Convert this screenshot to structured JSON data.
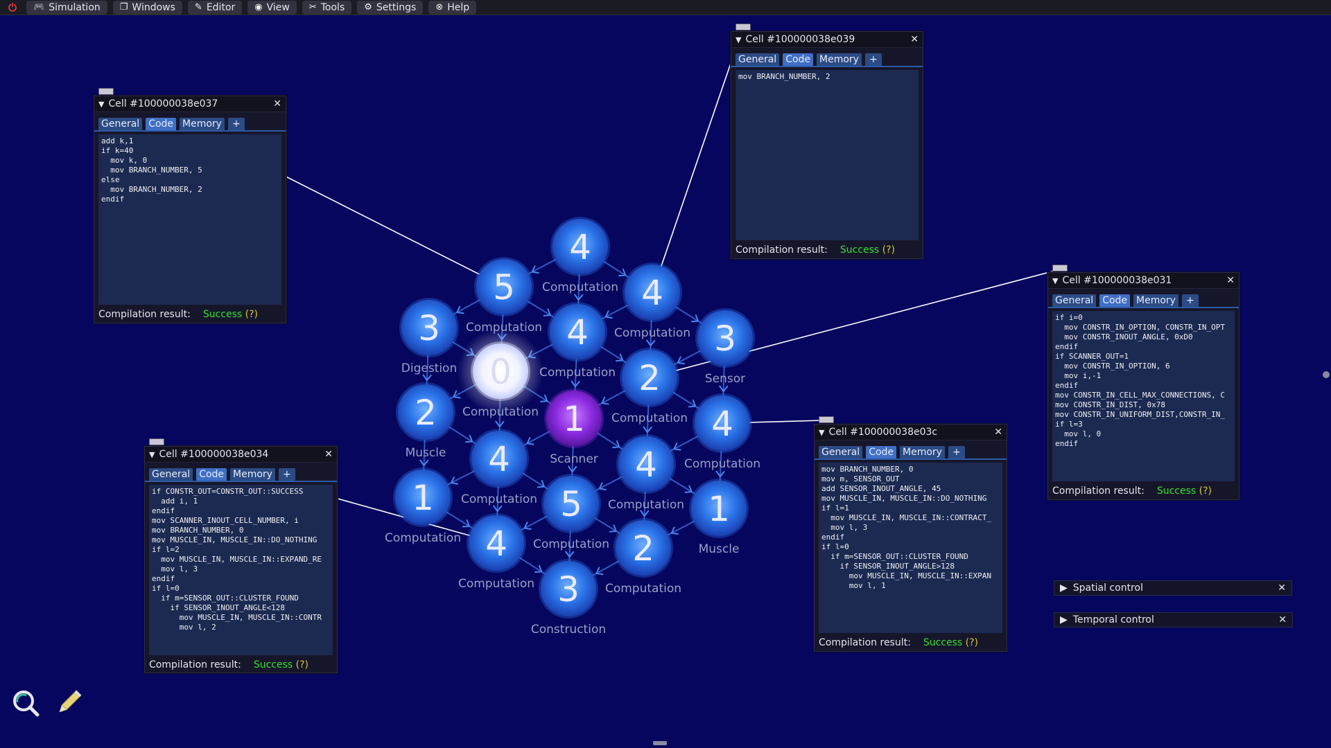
{
  "menubar": {
    "items": [
      {
        "label": "Simulation",
        "icon": "gamepad-icon"
      },
      {
        "label": "Windows",
        "icon": "windows-icon"
      },
      {
        "label": "Editor",
        "icon": "pencil-icon"
      },
      {
        "label": "View",
        "icon": "eye-icon"
      },
      {
        "label": "Tools",
        "icon": "tools-icon"
      },
      {
        "label": "Settings",
        "icon": "gear-icon"
      },
      {
        "label": "Help",
        "icon": "help-icon"
      }
    ]
  },
  "graph": {
    "cells": [
      {
        "id": "a",
        "num": "4",
        "fn": "Computation",
        "color": "#2a73e8"
      },
      {
        "id": "b",
        "num": "5",
        "fn": "Computation",
        "color": "#2a73e8"
      },
      {
        "id": "c",
        "num": "4",
        "fn": "Computation",
        "color": "#2a73e8"
      },
      {
        "id": "d",
        "num": "3",
        "fn": "Digestion",
        "color": "#2a73e8"
      },
      {
        "id": "e",
        "num": "4",
        "fn": "Computation",
        "color": "#2a73e8"
      },
      {
        "id": "f",
        "num": "3",
        "fn": "Sensor",
        "color": "#2a73e8"
      },
      {
        "id": "g",
        "num": "0",
        "fn": "Computation",
        "color": "#ffffff"
      },
      {
        "id": "h",
        "num": "2",
        "fn": "Computation",
        "color": "#2a73e8"
      },
      {
        "id": "i",
        "num": "2",
        "fn": "Muscle",
        "color": "#2a73e8"
      },
      {
        "id": "j",
        "num": "1",
        "fn": "Scanner",
        "color": "#8c2ae0"
      },
      {
        "id": "k",
        "num": "4",
        "fn": "Computation",
        "color": "#2a73e8"
      },
      {
        "id": "l",
        "num": "4",
        "fn": "Computation",
        "color": "#2a73e8"
      },
      {
        "id": "m",
        "num": "4",
        "fn": "Computation",
        "color": "#2a73e8"
      },
      {
        "id": "n",
        "num": "1",
        "fn": "Computation",
        "color": "#2a73e8"
      },
      {
        "id": "o",
        "num": "5",
        "fn": "Computation",
        "color": "#2a73e8"
      },
      {
        "id": "p",
        "num": "1",
        "fn": "Muscle",
        "color": "#2a73e8"
      },
      {
        "id": "q",
        "num": "4",
        "fn": "Computation",
        "color": "#2a73e8"
      },
      {
        "id": "r",
        "num": "2",
        "fn": "Computation",
        "color": "#2a73e8"
      },
      {
        "id": "s",
        "num": "3",
        "fn": "Construction",
        "color": "#2a73e8"
      }
    ]
  },
  "windows": [
    {
      "title": "Cell #100000038e037",
      "tabs": [
        "General",
        "Code",
        "Memory",
        "+"
      ],
      "active_tab": "Code",
      "code": "add k,1\nif k=40\n  mov k, 0\n  mov BRANCH_NUMBER, 5\nelse\n  mov BRANCH_NUMBER, 2\nendif",
      "result_label": "Compilation result:",
      "result_value": "Success",
      "result_help": "(?)"
    },
    {
      "title": "Cell #100000038e039",
      "tabs": [
        "General",
        "Code",
        "Memory",
        "+"
      ],
      "active_tab": "Code",
      "code": "mov BRANCH_NUMBER, 2",
      "result_label": "Compilation result:",
      "result_value": "Success",
      "result_help": "(?)"
    },
    {
      "title": "Cell #100000038e031",
      "tabs": [
        "General",
        "Code",
        "Memory",
        "+"
      ],
      "active_tab": "Code",
      "code": "if i=0\n  mov CONSTR_IN_OPTION, CONSTR_IN_OPT\n  mov CONSTR_INOUT_ANGLE, 0xD0\nendif\nif SCANNER_OUT=1\n  mov CONSTR_IN_OPTION, 6\n  mov i,-1\nendif\nmov CONSTR_IN_CELL_MAX_CONNECTIONS, C\nmov CONSTR_IN_DIST, 0x78\nmov CONSTR_IN_UNIFORM_DIST,CONSTR_IN_\nif l=3\n  mov l, 0\nendif",
      "result_label": "Compilation result:",
      "result_value": "Success",
      "result_help": "(?)"
    },
    {
      "title": "Cell #100000038e034",
      "tabs": [
        "General",
        "Code",
        "Memory",
        "+"
      ],
      "active_tab": "Code",
      "code": "if CONSTR_OUT=CONSTR_OUT::SUCCESS\n  add i, 1\nendif\nmov SCANNER_INOUT_CELL_NUMBER, i\nmov BRANCH_NUMBER, 0\nmov MUSCLE_IN, MUSCLE_IN::DO_NOTHING\nif l=2\n  mov MUSCLE_IN, MUSCLE_IN::EXPAND_RE\n  mov l, 3\nendif\nif l=0\n  if m=SENSOR_OUT::CLUSTER_FOUND\n    if SENSOR_INOUT_ANGLE<128\n      mov MUSCLE_IN, MUSCLE_IN::CONTR\n      mov l, 2",
      "result_label": "Compilation result:",
      "result_value": "Success",
      "result_help": "(?)"
    },
    {
      "title": "Cell #100000038e03c",
      "tabs": [
        "General",
        "Code",
        "Memory",
        "+"
      ],
      "active_tab": "Code",
      "code": "mov BRANCH_NUMBER, 0\nmov m, SENSOR_OUT\nadd SENSOR_INOUT_ANGLE, 45\nmov MUSCLE_IN, MUSCLE_IN::DO_NOTHING\nif l=1\n  mov MUSCLE_IN, MUSCLE_IN::CONTRACT_\n  mov l, 3\nendif\nif l=0\n  if m=SENSOR_OUT::CLUSTER_FOUND\n    if SENSOR_INOUT_ANGLE>128\n      mov MUSCLE_IN, MUSCLE_IN::EXPAN\n      mov l, 1",
      "result_label": "Compilation result:",
      "result_value": "Success",
      "result_help": "(?)"
    }
  ],
  "controls": [
    {
      "title": "Spatial control"
    },
    {
      "title": "Temporal control"
    }
  ],
  "tools": {
    "left_icon": "zoom-search-icon",
    "right_icon": "pencil-icon"
  }
}
